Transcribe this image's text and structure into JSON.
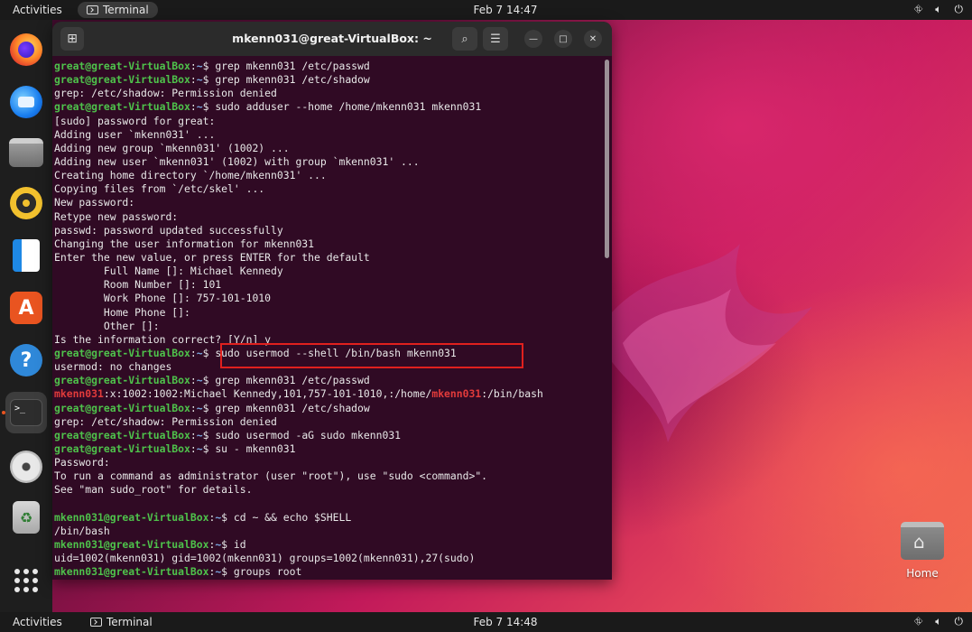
{
  "topbar": {
    "activities": "Activities",
    "app_name": "Terminal",
    "clock": "Feb 7  14:47"
  },
  "bottombar": {
    "activities": "Activities",
    "app_name": "Terminal",
    "clock": "Feb 7  14:48"
  },
  "tray": {
    "network_icon": "network-icon",
    "volume_icon": "volume-icon",
    "power_icon": "power-icon"
  },
  "dock": {
    "items": [
      {
        "name": "firefox",
        "icon": "firefox-icon"
      },
      {
        "name": "thunderbird",
        "icon": "thunderbird-icon"
      },
      {
        "name": "files",
        "icon": "files-icon"
      },
      {
        "name": "rhythmbox",
        "icon": "rhythmbox-icon"
      },
      {
        "name": "libreoffice-writer",
        "icon": "writer-icon"
      },
      {
        "name": "app-center",
        "icon": "store-icon",
        "glyph": "A"
      },
      {
        "name": "help",
        "icon": "help-icon",
        "glyph": "?"
      },
      {
        "name": "terminal",
        "icon": "terminal-icon",
        "glyph": ">_",
        "active": true
      },
      {
        "name": "disc",
        "icon": "disc-icon"
      },
      {
        "name": "trash",
        "icon": "trash-icon",
        "glyph": "♻"
      },
      {
        "name": "show-apps",
        "icon": "grid-icon"
      }
    ]
  },
  "terminal": {
    "title": "mkenn031@great-VirtualBox: ~",
    "lines": [
      {
        "type": "prompt",
        "user": "great@great-VirtualBox",
        "path": "~",
        "cmd": "grep mkenn031 /etc/passwd"
      },
      {
        "type": "prompt",
        "user": "great@great-VirtualBox",
        "path": "~",
        "cmd": "grep mkenn031 /etc/shadow"
      },
      {
        "type": "out",
        "text": "grep: /etc/shadow: Permission denied"
      },
      {
        "type": "prompt",
        "user": "great@great-VirtualBox",
        "path": "~",
        "cmd": "sudo adduser --home /home/mkenn031 mkenn031"
      },
      {
        "type": "out",
        "text": "[sudo] password for great:"
      },
      {
        "type": "out",
        "text": "Adding user `mkenn031' ..."
      },
      {
        "type": "out",
        "text": "Adding new group `mkenn031' (1002) ..."
      },
      {
        "type": "out",
        "text": "Adding new user `mkenn031' (1002) with group `mkenn031' ..."
      },
      {
        "type": "out",
        "text": "Creating home directory `/home/mkenn031' ..."
      },
      {
        "type": "out",
        "text": "Copying files from `/etc/skel' ..."
      },
      {
        "type": "out",
        "text": "New password:"
      },
      {
        "type": "out",
        "text": "Retype new password:"
      },
      {
        "type": "out",
        "text": "passwd: password updated successfully"
      },
      {
        "type": "out",
        "text": "Changing the user information for mkenn031"
      },
      {
        "type": "out",
        "text": "Enter the new value, or press ENTER for the default"
      },
      {
        "type": "out",
        "text": "        Full Name []: Michael Kennedy"
      },
      {
        "type": "out",
        "text": "        Room Number []: 101"
      },
      {
        "type": "out",
        "text": "        Work Phone []: 757-101-1010"
      },
      {
        "type": "out",
        "text": "        Home Phone []:"
      },
      {
        "type": "out",
        "text": "        Other []:"
      },
      {
        "type": "out",
        "text": "Is the information correct? [Y/n] y"
      },
      {
        "type": "prompt",
        "user": "great@great-VirtualBox",
        "path": "~",
        "cmd": "sudo usermod --shell /bin/bash mkenn031"
      },
      {
        "type": "out",
        "text": "usermod: no changes"
      },
      {
        "type": "prompt",
        "user": "great@great-VirtualBox",
        "path": "~",
        "cmd": "grep mkenn031 /etc/passwd"
      },
      {
        "type": "grepmatch",
        "match": "mkenn031",
        "mid": ":x:1002:1002:Michael Kennedy,101,757-101-1010,:/home/",
        "match2": "mkenn031",
        "tail": ":/bin/bash"
      },
      {
        "type": "prompt",
        "user": "great@great-VirtualBox",
        "path": "~",
        "cmd": "grep mkenn031 /etc/shadow"
      },
      {
        "type": "out",
        "text": "grep: /etc/shadow: Permission denied"
      },
      {
        "type": "prompt",
        "user": "great@great-VirtualBox",
        "path": "~",
        "cmd": "sudo usermod -aG sudo mkenn031"
      },
      {
        "type": "prompt",
        "user": "great@great-VirtualBox",
        "path": "~",
        "cmd": "su - mkenn031"
      },
      {
        "type": "out",
        "text": "Password:"
      },
      {
        "type": "out",
        "text": "To run a command as administrator (user \"root\"), use \"sudo <command>\"."
      },
      {
        "type": "out",
        "text": "See \"man sudo_root\" for details."
      },
      {
        "type": "out",
        "text": ""
      },
      {
        "type": "prompt",
        "user": "mkenn031@great-VirtualBox",
        "path": "~",
        "cmd": "cd ~ && echo $SHELL"
      },
      {
        "type": "out",
        "text": "/bin/bash"
      },
      {
        "type": "prompt",
        "user": "mkenn031@great-VirtualBox",
        "path": "~",
        "cmd": "id"
      },
      {
        "type": "out",
        "text": "uid=1002(mkenn031) gid=1002(mkenn031) groups=1002(mkenn031),27(sudo)"
      },
      {
        "type": "prompt",
        "user": "mkenn031@great-VirtualBox",
        "path": "~",
        "cmd": "groups root"
      }
    ]
  },
  "desktop": {
    "home_label": "Home"
  },
  "colors": {
    "terminal_bg": "#300a24",
    "prompt_user": "#4ec24b",
    "prompt_path": "#7aa8e0",
    "grep_match": "#e23b3b",
    "highlight_box": "#e0201e",
    "accent": "#e95420"
  }
}
